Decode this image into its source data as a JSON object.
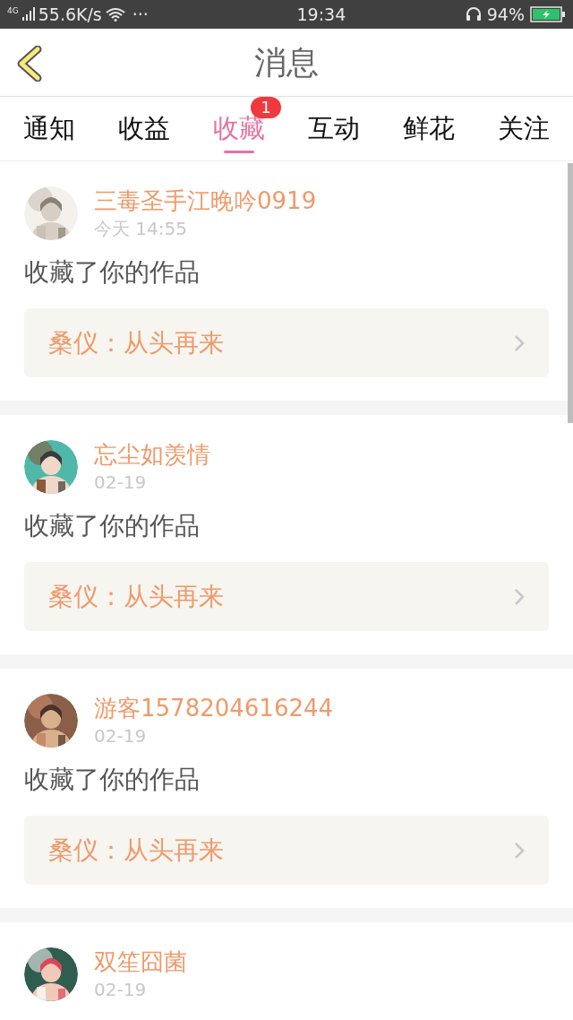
{
  "status_bar": {
    "network": "4G",
    "speed": "55.6K/s",
    "more": "···",
    "time": "19:34",
    "battery": "94%"
  },
  "header": {
    "title": "消息"
  },
  "tabs": [
    {
      "label": "通知",
      "selected": false
    },
    {
      "label": "收益",
      "selected": false
    },
    {
      "label": "收藏",
      "selected": true,
      "badge": "1"
    },
    {
      "label": "互动",
      "selected": false
    },
    {
      "label": "鲜花",
      "selected": false
    },
    {
      "label": "关注",
      "selected": false
    }
  ],
  "messages": [
    {
      "user": "三毒圣手江晚吟0919",
      "time": "今天 14:55",
      "action": "收藏了你的作品",
      "work": "桑仪：从头再来"
    },
    {
      "user": "忘尘如羡情",
      "time": "02-19",
      "action": "收藏了你的作品",
      "work": "桑仪：从头再来"
    },
    {
      "user": "游客1578204616244",
      "time": "02-19",
      "action": "收藏了你的作品",
      "work": "桑仪：从头再来"
    },
    {
      "user": "双笙囧菌",
      "time": "02-19"
    }
  ]
}
